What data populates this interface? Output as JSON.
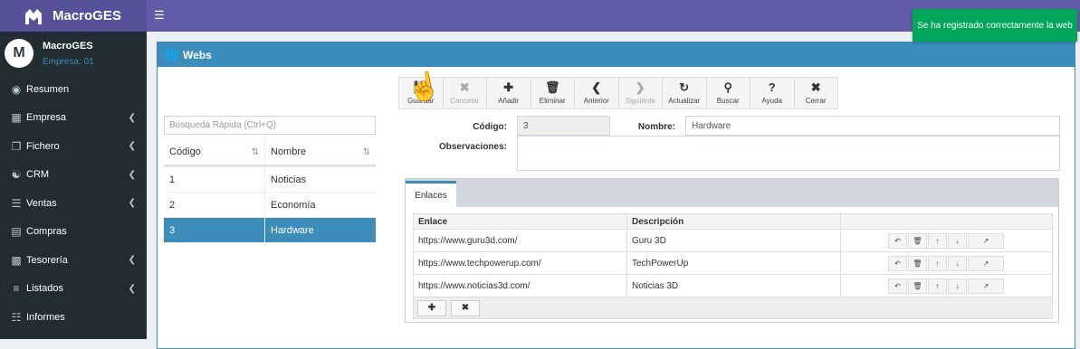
{
  "app": {
    "name": "MacroGES",
    "menu_icon": "hamburger-icon"
  },
  "toast": "Se ha registrado correctamente la web",
  "user": {
    "name": "MacroGES",
    "company": "Empresa: 01",
    "avatar": "M"
  },
  "sidebar": {
    "items": [
      {
        "label": "Resumen",
        "icon": "dashboard-icon",
        "chevron": false
      },
      {
        "label": "Empresa",
        "icon": "building-icon",
        "chevron": true
      },
      {
        "label": "Fichero",
        "icon": "files-icon",
        "chevron": true
      },
      {
        "label": "CRM",
        "icon": "handshake-icon",
        "chevron": true
      },
      {
        "label": "Ventas",
        "icon": "document-icon",
        "chevron": true
      },
      {
        "label": "Compras",
        "icon": "briefcase-icon",
        "chevron": false
      },
      {
        "label": "Tesorería",
        "icon": "money-icon",
        "chevron": true
      },
      {
        "label": "Listados",
        "icon": "list-icon",
        "chevron": true
      },
      {
        "label": "Informes",
        "icon": "report-icon",
        "chevron": false
      }
    ]
  },
  "panel": {
    "title": "Webs"
  },
  "toolbar": {
    "guardar": "Guardar",
    "cancelar": "Cancelar",
    "anadir": "Añadir",
    "eliminar": "Eliminar",
    "anterior": "Anterior",
    "siguiente": "Siguiente",
    "actualizar": "Actualizar",
    "buscar": "Buscar",
    "ayuda": "Ayuda",
    "cerrar": "Cerrar"
  },
  "search": {
    "placeholder": "Búsqueda Rápida (Ctrl+Q)"
  },
  "list": {
    "headers": {
      "codigo": "Código",
      "nombre": "Nombre"
    },
    "rows": [
      {
        "codigo": "1",
        "nombre": "Noticias"
      },
      {
        "codigo": "2",
        "nombre": "Economía"
      },
      {
        "codigo": "3",
        "nombre": "Hardware"
      }
    ]
  },
  "form": {
    "codigo_label": "Código:",
    "codigo_value": "3",
    "nombre_label": "Nombre:",
    "nombre_value": "Hardware",
    "observaciones_label": "Observaciones:",
    "observaciones_value": ""
  },
  "tabs": {
    "enlaces": "Enlaces"
  },
  "links": {
    "headers": {
      "enlace": "Enlace",
      "descripcion": "Descripción"
    },
    "rows": [
      {
        "enlace": "https://www.guru3d.com/",
        "descripcion": "Guru 3D"
      },
      {
        "enlace": "https://www.techpowerup.com/",
        "descripcion": "TechPowerUp"
      },
      {
        "enlace": "https://www.noticias3d.com/",
        "descripcion": "Noticias 3D"
      }
    ]
  }
}
